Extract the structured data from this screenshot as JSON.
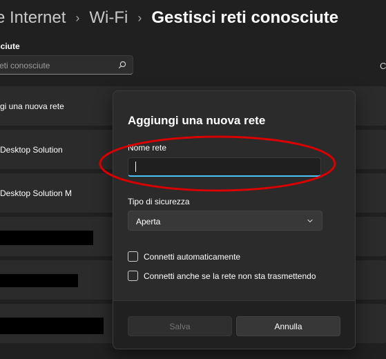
{
  "breadcrumb": {
    "parent": "e Internet",
    "middle": "Wi-Fi",
    "current": "Gestisci reti conosciute",
    "separator": "›"
  },
  "section_label": "sciute",
  "search": {
    "placeholder": "eti conosciute"
  },
  "right_edge_letter": "C",
  "networks": [
    {
      "label": "gi una nuova rete"
    },
    {
      "label": "Desktop Solution"
    },
    {
      "label": "Desktop Solution M"
    }
  ],
  "dialog": {
    "title": "Aggiungi una nuova rete",
    "name_label": "Nome rete",
    "name_value": "",
    "security_label": "Tipo di sicurezza",
    "security_value": "Aperta",
    "auto_connect_label": "Connetti automaticamente",
    "hidden_connect_label": "Connetti anche se la rete non sta trasmettendo",
    "save_label": "Salva",
    "cancel_label": "Annulla"
  },
  "colors": {
    "background": "#202020",
    "dialog": "#2b2b2b",
    "accent": "#4cc2ff",
    "annotation": "#d90000"
  }
}
